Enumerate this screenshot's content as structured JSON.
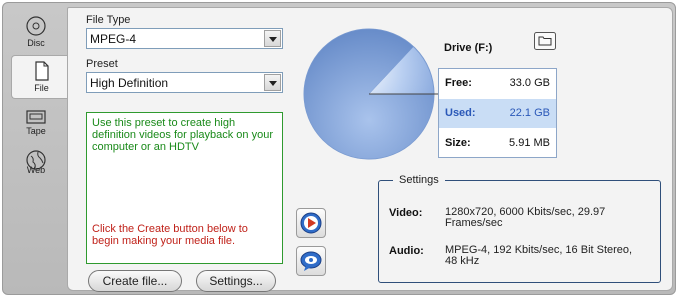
{
  "sidebar": {
    "items": [
      {
        "label": "Disc",
        "icon": "disc-icon"
      },
      {
        "label": "File",
        "icon": "file-icon",
        "active": true
      },
      {
        "label": "Tape",
        "icon": "tape-icon"
      },
      {
        "label": "Web",
        "icon": "globe-icon"
      }
    ]
  },
  "file_type": {
    "label": "File Type",
    "value": "MPEG-4"
  },
  "preset": {
    "label": "Preset",
    "value": "High Definition"
  },
  "description": {
    "text": "Use this preset to create high definition videos for playback on your computer or an HDTV",
    "hint": "Click the Create button below to begin making your media file."
  },
  "buttons": {
    "create": "Create file...",
    "settings": "Settings..."
  },
  "side_buttons": [
    {
      "icon": "play-icon"
    },
    {
      "icon": "speech-bubble-icon"
    }
  ],
  "drive": {
    "title": "Drive (F:)",
    "used_fraction": 0.87,
    "rows": [
      {
        "key": "Free:",
        "value": "33.0 GB"
      },
      {
        "key": "Used:",
        "value": "22.1 GB"
      },
      {
        "key": "Size:",
        "value": "5.91 MB"
      }
    ]
  },
  "settings": {
    "legend": "Settings",
    "video_label": "Video:",
    "video_value": "1280x720, 6000 Kbits/sec, 29.97 Frames/sec",
    "audio_label": "Audio:",
    "audio_value": "MPEG-4, 192 Kbits/sec, 16 Bit Stereo, 48 kHz"
  },
  "colors": {
    "accent": "#2a58b8",
    "description_text": "#1a8a1a",
    "hint_text": "#c0221a"
  }
}
